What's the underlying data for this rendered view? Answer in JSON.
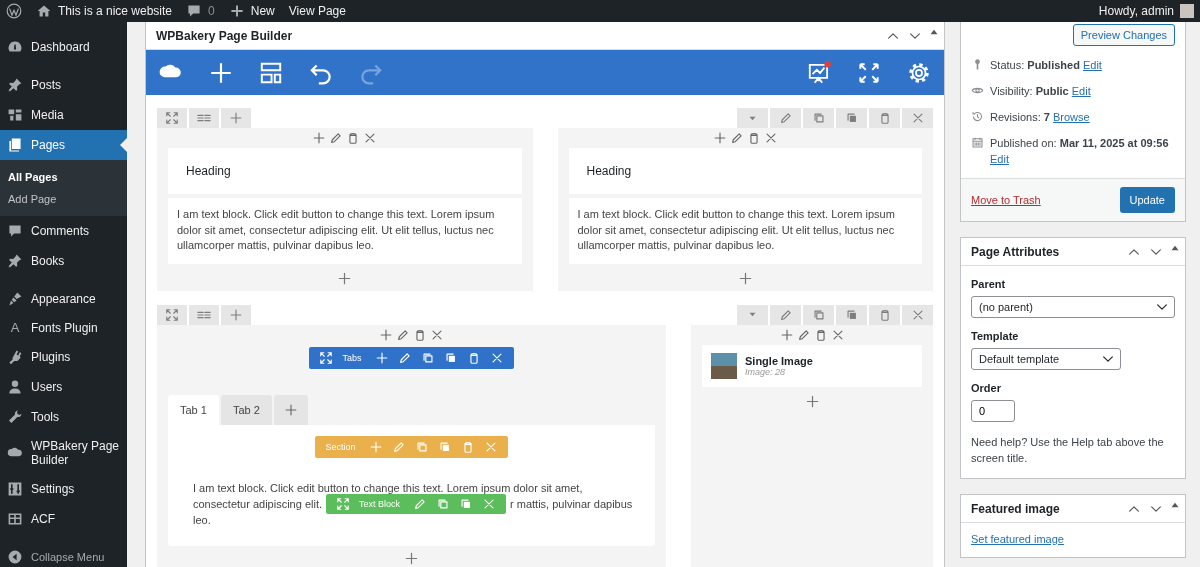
{
  "admin_bar": {
    "site_name": "This is a nice website",
    "comments": "0",
    "new": "New",
    "view": "View Page",
    "greeting": "Howdy, admin"
  },
  "menu_groups": [
    [
      {
        "label": "Dashboard",
        "selected": false
      }
    ],
    [
      {
        "label": "Posts",
        "selected": false
      },
      {
        "label": "Media",
        "selected": false
      },
      {
        "label": "Pages",
        "selected": true,
        "children": [
          {
            "label": "All Pages",
            "selected": true
          },
          {
            "label": "Add Page",
            "selected": false
          }
        ]
      },
      {
        "label": "Comments",
        "selected": false
      },
      {
        "label": "Books",
        "selected": false
      }
    ],
    [
      {
        "label": "Appearance",
        "selected": false
      },
      {
        "label": "Fonts Plugin",
        "glyph": "A",
        "selected": false
      },
      {
        "label": "Plugins",
        "selected": false
      },
      {
        "label": "Users",
        "selected": false
      },
      {
        "label": "Tools",
        "selected": false
      },
      {
        "label": "WPBakery Page Builder",
        "selected": false
      },
      {
        "label": "Settings",
        "selected": false
      },
      {
        "label": "ACF",
        "selected": false
      }
    ]
  ],
  "collapse_label": "Collapse Menu",
  "builder": {
    "title": "WPBakery Page Builder",
    "redo_disabled": true,
    "rows": [
      {
        "columns": [
          {
            "elements": [
              {
                "kind": "heading",
                "text": "Heading"
              },
              {
                "kind": "text",
                "text": "I am text block. Click edit button to change this text. Lorem ipsum dolor sit amet, consectetur adipiscing elit. Ut elit tellus, luctus nec ullamcorper mattis, pulvinar dapibus leo."
              }
            ]
          },
          {
            "elements": [
              {
                "kind": "heading",
                "text": "Heading"
              },
              {
                "kind": "text",
                "text": "I am text block. Click edit button to change this text. Lorem ipsum dolor sit amet, consectetur adipiscing elit. Ut elit tellus, luctus nec ullamcorper mattis, pulvinar dapibus leo."
              }
            ]
          }
        ]
      },
      {
        "columns": [
          {
            "elements": [
              {
                "kind": "tabs",
                "toolbar": "Tabs",
                "tabs": [
                  {
                    "label": "Tab 1",
                    "selected": true
                  },
                  {
                    "label": "Tab 2",
                    "selected": false
                  }
                ],
                "section": {
                  "toolbar": "Section",
                  "line_1": "I am text block. Click edit button to change this text. Lorem ipsum dolor sit amet,",
                  "line_2_before": "consectetur adipiscing elit.",
                  "text_block_toolbar": "Text Block",
                  "line_2_after": "r mattis, pulvinar dapibus",
                  "line_3": "leo."
                }
              }
            ]
          },
          {
            "elements": [
              {
                "kind": "image",
                "title": "Single Image",
                "caption": "Image: 28"
              }
            ]
          }
        ]
      }
    ]
  },
  "publish": {
    "preview": "Preview Changes",
    "meta": [
      {
        "label": "Status:",
        "value": "Published",
        "link": "Edit"
      },
      {
        "label": "Visibility:",
        "value": "Public",
        "link": "Edit"
      },
      {
        "label": "Revisions:",
        "value": "7",
        "link": "Browse"
      },
      {
        "label": "Published on:",
        "value": "Mar 11, 2025 at 09:56",
        "link": "Edit"
      }
    ],
    "trash": "Move to Trash",
    "update": "Update"
  },
  "page_attributes": {
    "title": "Page Attributes",
    "parent_label": "Parent",
    "parent_value": "(no parent)",
    "template_label": "Template",
    "template_value": "Default template",
    "order_label": "Order",
    "order_value": "0",
    "help": "Need help? Use the Help tab above the screen title."
  },
  "featured_image": {
    "title": "Featured image",
    "link": "Set featured image"
  }
}
